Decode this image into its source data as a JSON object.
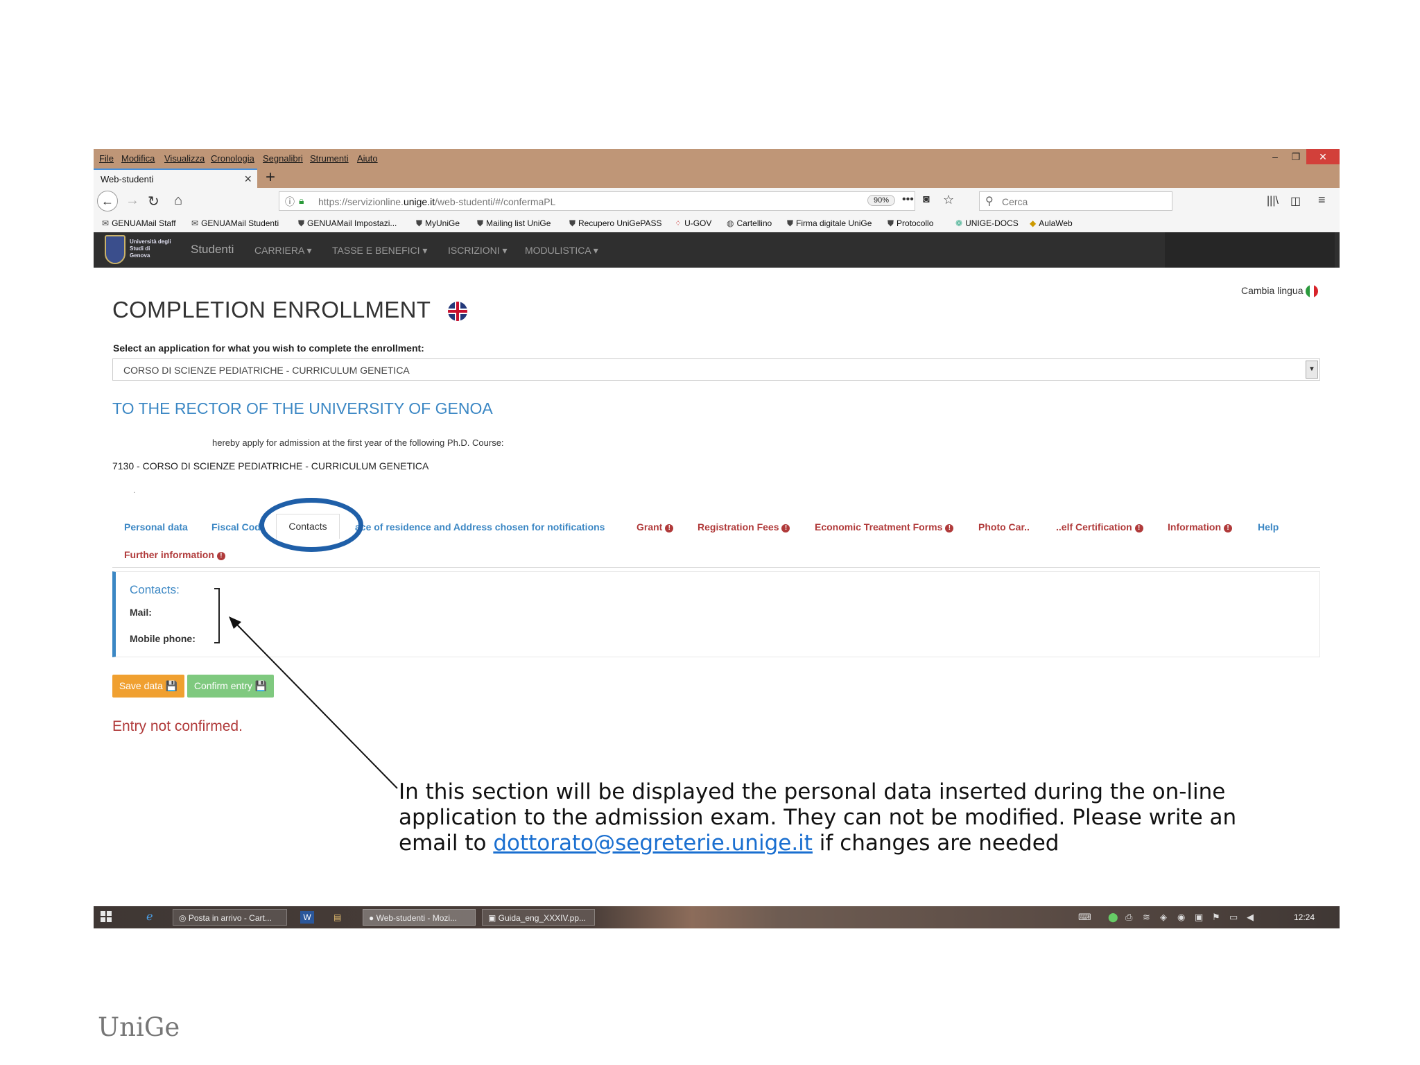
{
  "browser": {
    "menu": [
      "File",
      "Modifica",
      "Visualizza",
      "Cronologia",
      "Segnalibri",
      "Strumenti",
      "Aiuto"
    ],
    "tab_title": "Web-studenti",
    "url_prefix": "https://servizionline.",
    "url_domain": "unige.it",
    "url_path": "/web-studenti/#/confermaPL",
    "zoom": "90%",
    "search_placeholder": "Cerca",
    "bookmarks": [
      "GENUAMail Staff",
      "GENUAMail Studenti",
      "GENUAMail Impostazi...",
      "MyUniGe",
      "Mailing list UniGe",
      "Recupero UniGePASS",
      "U-GOV",
      "Cartellino",
      "Firma digitale UniGe",
      "Protocollo",
      "UNIGE-DOCS",
      "AulaWeb"
    ]
  },
  "site_nav": {
    "logo_text": "Università degli Studi di Genova",
    "items": [
      "Studenti",
      "CARRIERA ▾",
      "TASSE E BENEFICI ▾",
      "ISCRIZIONI ▾",
      "MODULISTICA ▾"
    ]
  },
  "page": {
    "cambia_lingua": "Cambia lingua",
    "title": "COMPLETION ENROLLMENT",
    "select_label": "Select an application for what you wish to complete the enrollment:",
    "select_value": "CORSO DI SCIENZE PEDIATRICHE - CURRICULUM GENETICA",
    "rector_heading": "TO THE RECTOR OF THE UNIVERSITY OF GENOA",
    "apply_text": "hereby apply for admission at the first year of the following Ph.D. Course:",
    "course_line": "7130 - CORSO DI SCIENZE PEDIATRICHE - CURRICULUM GENETICA",
    "dot": "."
  },
  "tabs": {
    "personal_data": "Personal data",
    "fiscal_code": "Fiscal Cod",
    "contacts": "Contacts",
    "residence": "ace of residence and Address chosen for notifications",
    "grant": "Grant",
    "registration_fees": "Registration Fees",
    "economic_forms": "Economic Treatment Forms",
    "photo_card": "Photo Car..",
    "self_cert": "..elf Certification",
    "information": "Information",
    "help": "Help",
    "further_information": "Further information",
    "bang": "!"
  },
  "contacts_panel": {
    "title": "Contacts:",
    "mail_label": "Mail:",
    "mobile_label": "Mobile phone:"
  },
  "buttons": {
    "save": "Save data 💾",
    "confirm": "Confirm entry 💾"
  },
  "status": "Entry not confirmed.",
  "annotation": {
    "text_before": "In this section will be displayed the personal data inserted during the on-line application to the admission exam. They can not be modified. Please write an email to ",
    "email": "dottorato@segreterie.unige.it",
    "text_after": " if changes are needed"
  },
  "taskbar": {
    "apps": [
      "Posta in arrivo - Cart...",
      "Web-studenti - Mozi...",
      "Guida_eng_XXXIV.pp..."
    ],
    "clock": "12:24"
  },
  "footer_logo": "UniGe",
  "colors": {
    "browser_chrome": "#bf9677",
    "link_blue": "#3b87c4",
    "error_red": "#b03a3a",
    "save_orange": "#f0a030",
    "confirm_green": "#7fc97f",
    "highlight_ellipse": "#1f5fa8"
  }
}
